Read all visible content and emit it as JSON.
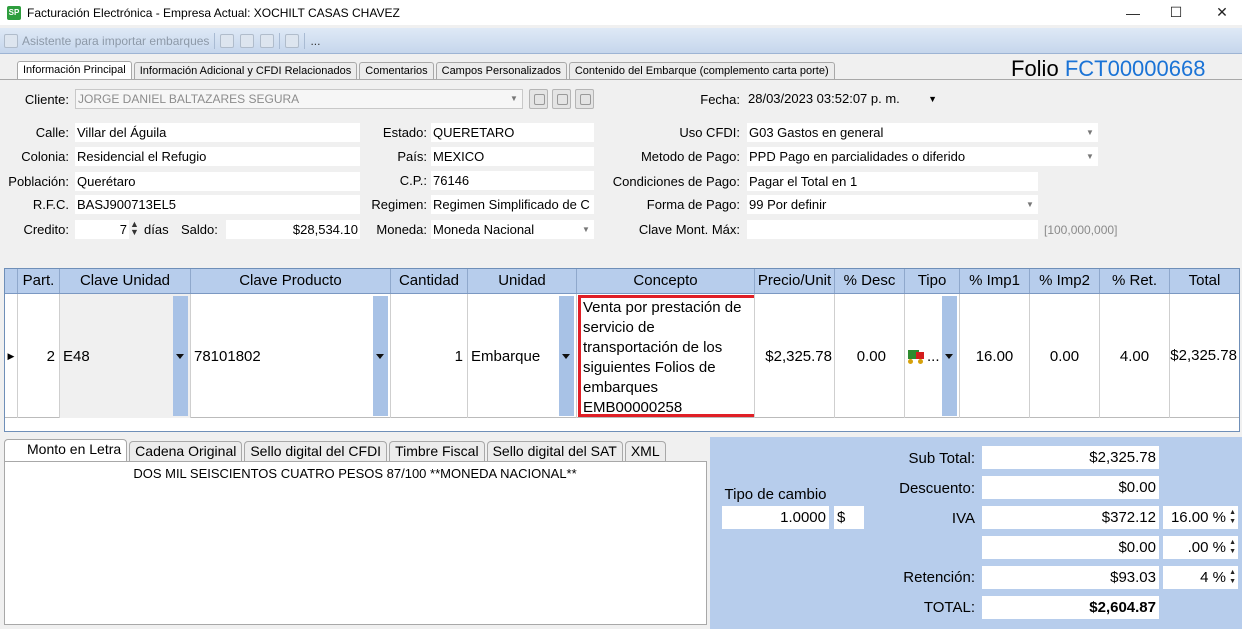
{
  "window": {
    "title": "Facturación Electrónica - Empresa Actual: XOCHILT CASAS CHAVEZ",
    "app_icon": "SP",
    "minimize": "—",
    "maximize": "☐",
    "close": "✕"
  },
  "toolbar": {
    "import_label": "Asistente para importar embarques",
    "more_label": "..."
  },
  "tabs": [
    "Información Principal",
    "Información Adicional y CFDI Relacionados",
    "Comentarios",
    "Campos Personalizados",
    "Contenido del Embarque (complemento carta porte)"
  ],
  "folio": {
    "label": "Folio",
    "value": "FCT00000668"
  },
  "header": {
    "cliente_label": "Cliente:",
    "cliente": "JORGE DANIEL BALTAZARES SEGURA",
    "fecha_label": "Fecha:",
    "fecha": "28/03/2023 03:52:07 p. m.",
    "calle_label": "Calle:",
    "calle": "Villar del Águila",
    "colonia_label": "Colonia:",
    "colonia": "Residencial el Refugio",
    "poblacion_label": "Población:",
    "poblacion": "Querétaro",
    "rfc_label": "R.F.C.",
    "rfc": "BASJ900713EL5",
    "credito_label": "Credito:",
    "credito": "7",
    "dias_label": "días",
    "saldo_label": "Saldo:",
    "saldo": "$28,534.10",
    "estado_label": "Estado:",
    "estado": "QUERETARO",
    "pais_label": "País:",
    "pais": "MEXICO",
    "cp_label": "C.P.:",
    "cp": "76146",
    "regimen_label": "Regimen:",
    "regimen": "Regimen Simplificado de C",
    "moneda_label": "Moneda:",
    "moneda": "Moneda Nacional",
    "uso_cfdi_label": "Uso CFDI:",
    "uso_cfdi": "G03 Gastos en general",
    "metodo_pago_label": "Metodo de Pago:",
    "metodo_pago": "PPD Pago en parcialidades o diferido",
    "condiciones_label": "Condiciones de Pago:",
    "condiciones": "Pagar el Total en 1",
    "forma_pago_label": "Forma de Pago:",
    "forma_pago": "99 Por definir",
    "clave_mont_label": "Clave Mont. Máx:",
    "clave_mont": "",
    "clave_mont_hint": "[100,000,000]"
  },
  "grid": {
    "columns": [
      "Part.",
      "Clave Unidad",
      "Clave Producto",
      "Cantidad",
      "Unidad",
      "Concepto",
      "Precio/Unit",
      "% Desc",
      "Tipo",
      "% Imp1",
      "% Imp2",
      "% Ret.",
      "Total"
    ],
    "row": {
      "part": "2",
      "clave_unidad": "E48",
      "clave_producto": "78101802",
      "cantidad": "1",
      "unidad": "Embarque",
      "concepto": "Venta por prestación de servicio de transportación de los siguientes Folios de embarques EMB00000258",
      "precio_unit": "$2,325.78",
      "desc": "0.00",
      "tipo": "...",
      "imp1": "16.00",
      "imp2": "0.00",
      "ret": "4.00",
      "total": "$2,325.78"
    }
  },
  "bottom_tabs": [
    "Monto en Letra",
    "Cadena Original",
    "Sello digital del CFDI",
    "Timbre Fiscal",
    "Sello digital del SAT",
    "XML"
  ],
  "monto_letra": "DOS MIL SEISCIENTOS CUATRO PESOS 87/100 **MONEDA NACIONAL**",
  "totals": {
    "tipo_cambio_label": "Tipo de cambio",
    "tipo_cambio": "1.0000",
    "currency_symbol": "$",
    "subtotal_label": "Sub Total:",
    "subtotal": "$2,325.78",
    "descuento_label": "Descuento:",
    "descuento": "$0.00",
    "iva_label": "IVA",
    "iva": "$372.12",
    "iva_pct": "16.00 %",
    "imp2": "$0.00",
    "imp2_pct": ".00 %",
    "retencion_label": "Retención:",
    "retencion": "$93.03",
    "retencion_pct": "4 %",
    "total_label": "TOTAL:",
    "total": "$2,604.87"
  }
}
